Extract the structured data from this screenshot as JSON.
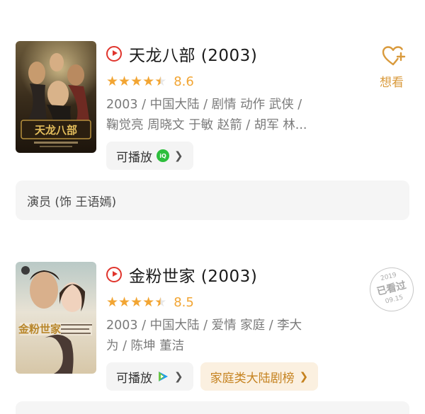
{
  "movies": [
    {
      "title": "天龙八部 (2003)",
      "rating": 4.5,
      "score": "8.6",
      "meta_lines": [
        "2003 / 中国大陆 / 剧情 动作 武侠 /",
        "鞠觉亮 周晓文 于敏 赵箭 / 胡军 林..."
      ],
      "play_label": "可播放",
      "platform_icon": "iqiyi-icon",
      "want_label": "想看",
      "poster_title": "天龙八部"
    },
    {
      "title": "金粉世家 (2003)",
      "rating": 4.5,
      "score": "8.5",
      "meta_lines": [
        "2003 / 中国大陆 / 爱情 家庭 / 李大",
        "为 / 陈坤 董洁"
      ],
      "play_label": "可播放",
      "platform_icon": "tencent-video-icon",
      "rank_label": "家庭类大陆剧榜",
      "watched_stamp": {
        "year": "2019",
        "text": "已看过",
        "date": "09.15"
      },
      "poster_title": "金粉世家"
    }
  ],
  "cast_bar_text": "演员 (饰 王语嫣)",
  "colors": {
    "star": "#f2a533",
    "play": "#e0342c",
    "want": "#d99a3c",
    "iqiyi": "#2dbe3c",
    "rank_bg": "#fbf0e0"
  }
}
